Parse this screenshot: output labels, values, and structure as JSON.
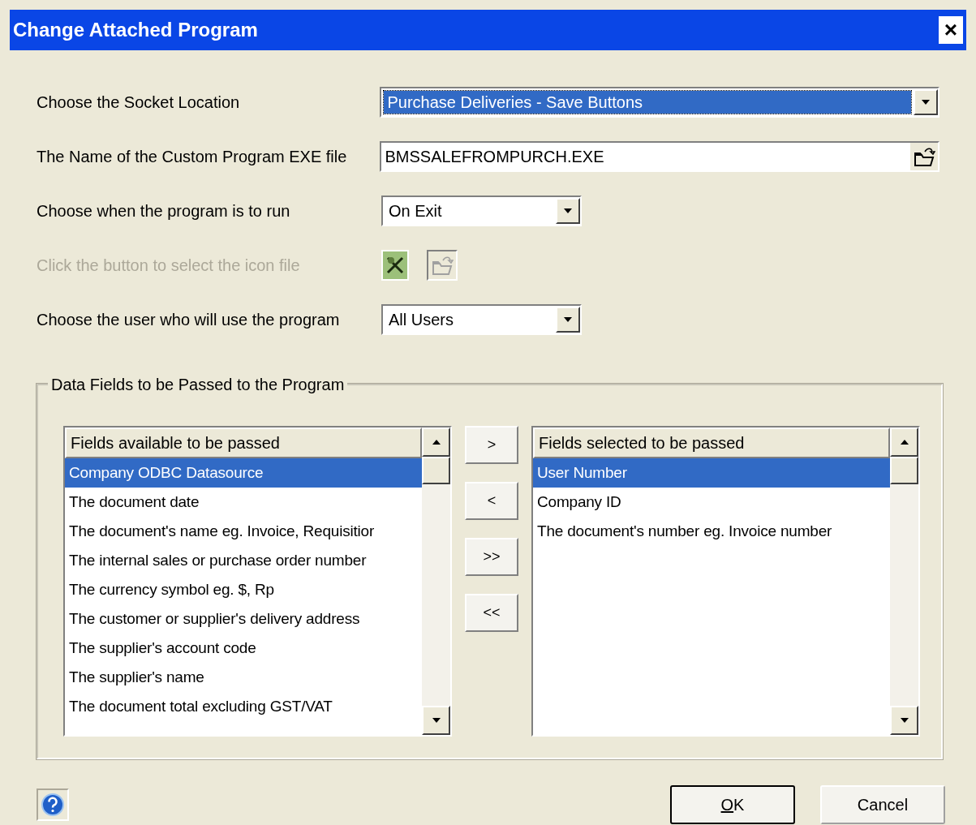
{
  "window": {
    "title": "Change Attached Program",
    "close": "×"
  },
  "fields": [
    {
      "kind": "combo",
      "label": "Choose the Socket Location",
      "value": "Purchase Deliveries - Save Buttons",
      "disabled": false,
      "selected": true,
      "wide": true
    },
    {
      "kind": "file",
      "label": "The Name of the Custom Program EXE file",
      "value": "BMSSALEFROMPURCH.EXE",
      "disabled": false
    },
    {
      "kind": "combo",
      "label": "Choose when the program is to run",
      "value": "On Exit",
      "disabled": false,
      "selected": false,
      "wide": false
    },
    {
      "kind": "icon",
      "label": "Click the button to select the icon file",
      "disabled": true
    },
    {
      "kind": "combo",
      "label": "Choose the user who will use the program",
      "value": "All Users",
      "disabled": false,
      "selected": false,
      "wide": false
    }
  ],
  "group": {
    "title": "Data Fields to be Passed to the Program",
    "available": {
      "header": "Fields available to be passed",
      "items": [
        {
          "label": "Company ODBC Datasource",
          "selected": true
        },
        {
          "label": "The document date",
          "selected": false
        },
        {
          "label": "The document's name eg. Invoice, Requisitior",
          "selected": false
        },
        {
          "label": "The internal sales or purchase order number",
          "selected": false
        },
        {
          "label": "The currency symbol eg. $, Rp",
          "selected": false
        },
        {
          "label": "The customer or supplier's delivery address",
          "selected": false
        },
        {
          "label": "The supplier's account code",
          "selected": false
        },
        {
          "label": "The supplier's name",
          "selected": false
        },
        {
          "label": "The document total excluding GST/VAT",
          "selected": false
        }
      ]
    },
    "move_buttons": [
      ">",
      "<",
      ">>",
      "<<"
    ],
    "selected_list": {
      "header": "Fields selected to be passed",
      "items": [
        {
          "label": "User Number",
          "selected": true
        },
        {
          "label": "Company ID",
          "selected": false
        },
        {
          "label": "The document's number eg. Invoice number",
          "selected": false
        }
      ]
    }
  },
  "buttons": [
    {
      "label": "OK",
      "default": true,
      "underline_first": true
    },
    {
      "label": "Cancel",
      "default": false,
      "underline_first": false
    }
  ]
}
